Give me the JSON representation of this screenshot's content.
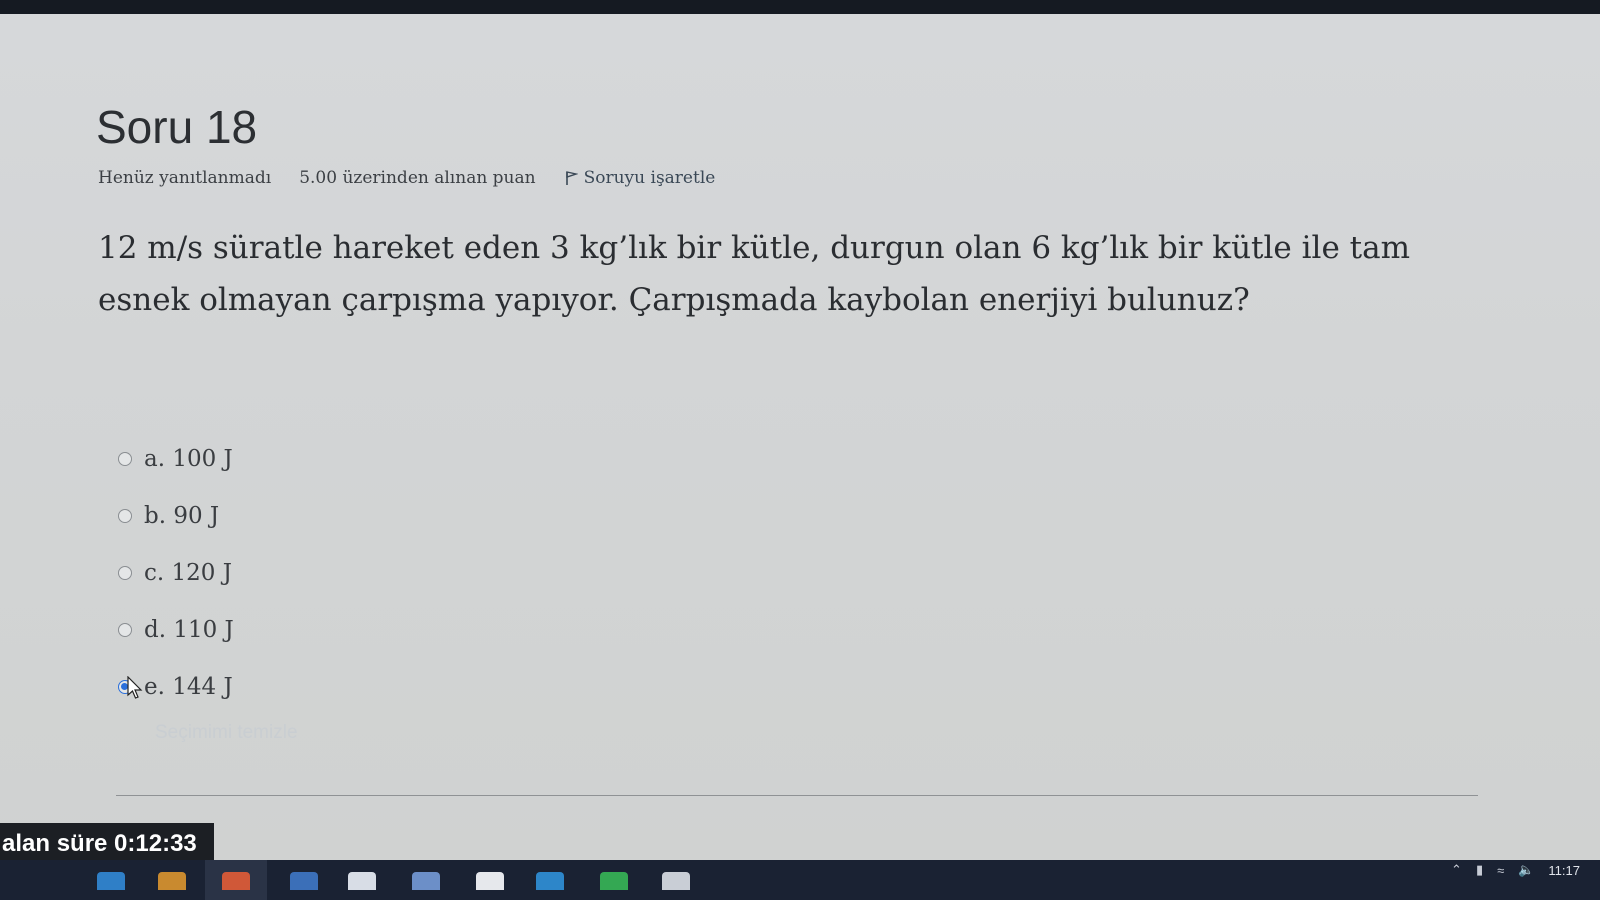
{
  "question": {
    "title": "Soru 18",
    "status": "Henüz yanıtlanmadı",
    "points": "5.00 üzerinden alınan puan",
    "flag_label": "Soruyu işaretle",
    "text": "12 m/s süratle hareket eden 3 kg’lık bir kütle, durgun olan 6 kg’lık bir kütle ile tam esnek olmayan çarpışma yapıyor. Çarpışmada kaybolan enerjiyi bulunuz?"
  },
  "answers": [
    {
      "label": "a. 100 J",
      "selected": false
    },
    {
      "label": "b. 90 J",
      "selected": false
    },
    {
      "label": "c. 120 J",
      "selected": false
    },
    {
      "label": "d. 110 J",
      "selected": false
    },
    {
      "label": "e. 144 J",
      "selected": true
    }
  ],
  "clear_choice": "Seçimimi temizle",
  "timer": {
    "text": "alan süre 0:12:33"
  },
  "taskbar": {
    "clock_time": "11:17"
  },
  "colors": {
    "accent": "#2a6fdb",
    "taskbar": "#1a2233"
  }
}
